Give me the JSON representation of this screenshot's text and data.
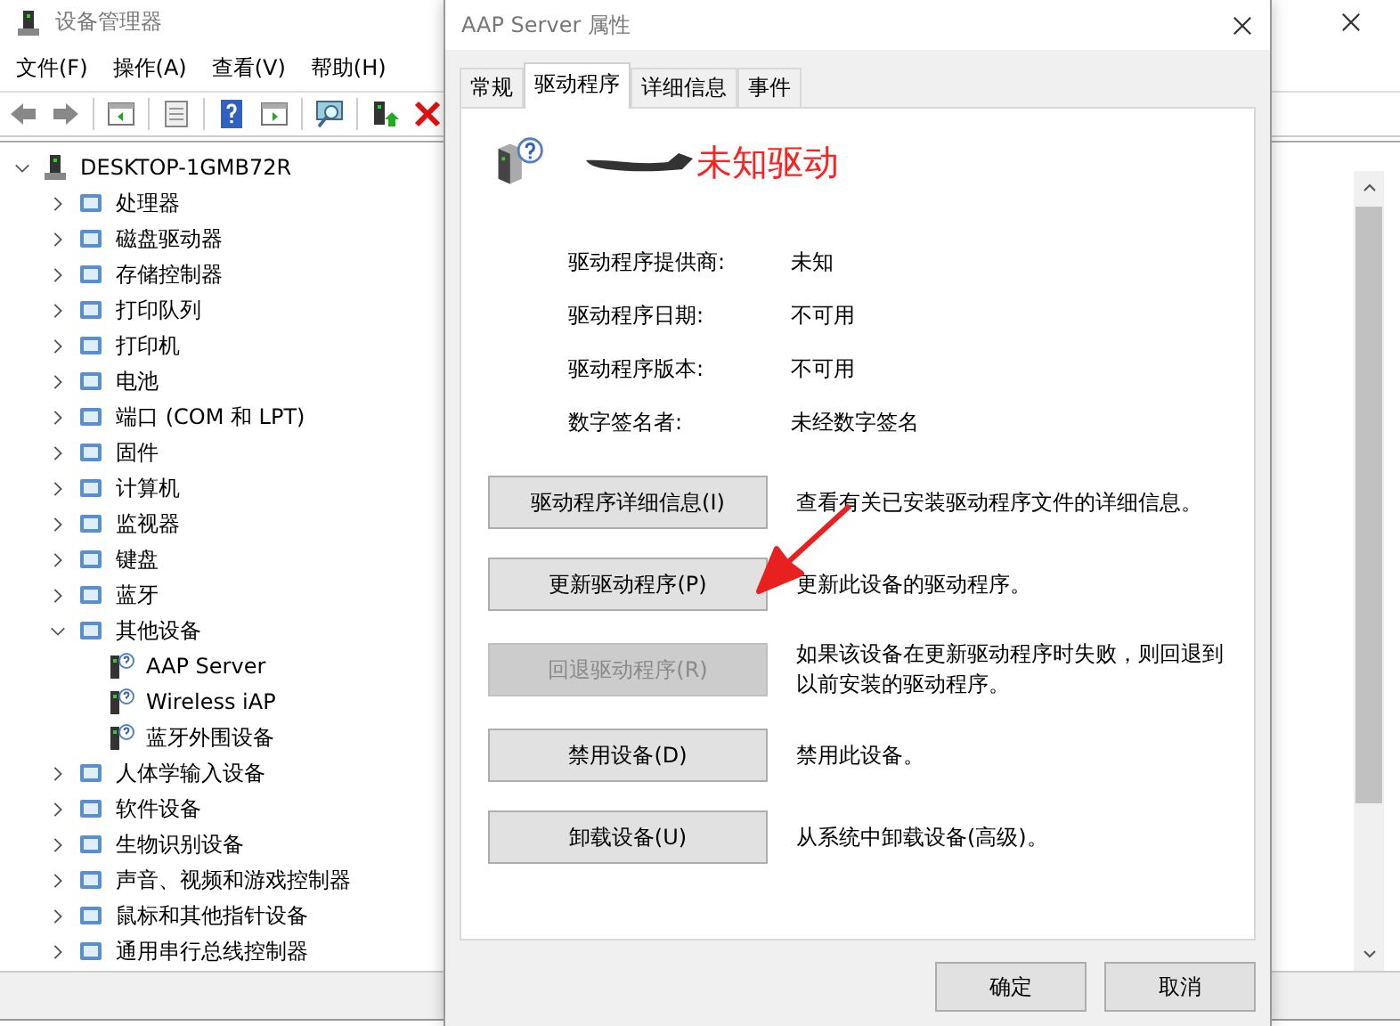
{
  "main_window": {
    "title": "设备管理器",
    "menu": [
      "文件(F)",
      "操作(A)",
      "查看(V)",
      "帮助(H)"
    ],
    "tree": {
      "label": "DESKTOP-1GMB72R",
      "expanded": true,
      "children": [
        {
          "label": "处理器",
          "expanded": false
        },
        {
          "label": "磁盘驱动器",
          "expanded": false
        },
        {
          "label": "存储控制器",
          "expanded": false
        },
        {
          "label": "打印队列",
          "expanded": false
        },
        {
          "label": "打印机",
          "expanded": false
        },
        {
          "label": "电池",
          "expanded": false
        },
        {
          "label": "端口 (COM 和 LPT)",
          "expanded": false
        },
        {
          "label": "固件",
          "expanded": false
        },
        {
          "label": "计算机",
          "expanded": false
        },
        {
          "label": "监视器",
          "expanded": false
        },
        {
          "label": "键盘",
          "expanded": false
        },
        {
          "label": "蓝牙",
          "expanded": false
        },
        {
          "label": "其他设备",
          "expanded": true,
          "children": [
            {
              "label": "AAP Server"
            },
            {
              "label": "Wireless iAP"
            },
            {
              "label": "蓝牙外围设备"
            }
          ]
        },
        {
          "label": "人体学输入设备",
          "expanded": false
        },
        {
          "label": "软件设备",
          "expanded": false
        },
        {
          "label": "生物识别设备",
          "expanded": false
        },
        {
          "label": "声音、视频和游戏控制器",
          "expanded": false
        },
        {
          "label": "鼠标和其他指针设备",
          "expanded": false
        },
        {
          "label": "通用串行总线控制器",
          "expanded": false
        }
      ]
    }
  },
  "dialog": {
    "title": "AAP Server 属性",
    "tabs": [
      {
        "label": "常规",
        "selected": false
      },
      {
        "label": "驱动程序",
        "selected": true
      },
      {
        "label": "详细信息",
        "selected": false
      },
      {
        "label": "事件",
        "selected": false
      }
    ],
    "annotation_text": "未知驱动",
    "properties": [
      {
        "label": "驱动程序提供商:",
        "value": "未知"
      },
      {
        "label": "驱动程序日期:",
        "value": "不可用"
      },
      {
        "label": "驱动程序版本:",
        "value": "不可用"
      },
      {
        "label": "数字签名者:",
        "value": "未经数字签名"
      }
    ],
    "actions": [
      {
        "button": "驱动程序详细信息(I)",
        "description": "查看有关已安装驱动程序文件的详细信息。",
        "disabled": false
      },
      {
        "button": "更新驱动程序(P)",
        "description": "更新此设备的驱动程序。",
        "disabled": false
      },
      {
        "button": "回退驱动程序(R)",
        "description": "如果该设备在更新驱动程序时失败，则回退到以前安装的驱动程序。",
        "disabled": true
      },
      {
        "button": "禁用设备(D)",
        "description": "禁用此设备。",
        "disabled": false
      },
      {
        "button": "卸载设备(U)",
        "description": "从系统中卸载设备(高级)。",
        "disabled": false
      }
    ],
    "buttons": [
      "确定",
      "取消"
    ]
  }
}
